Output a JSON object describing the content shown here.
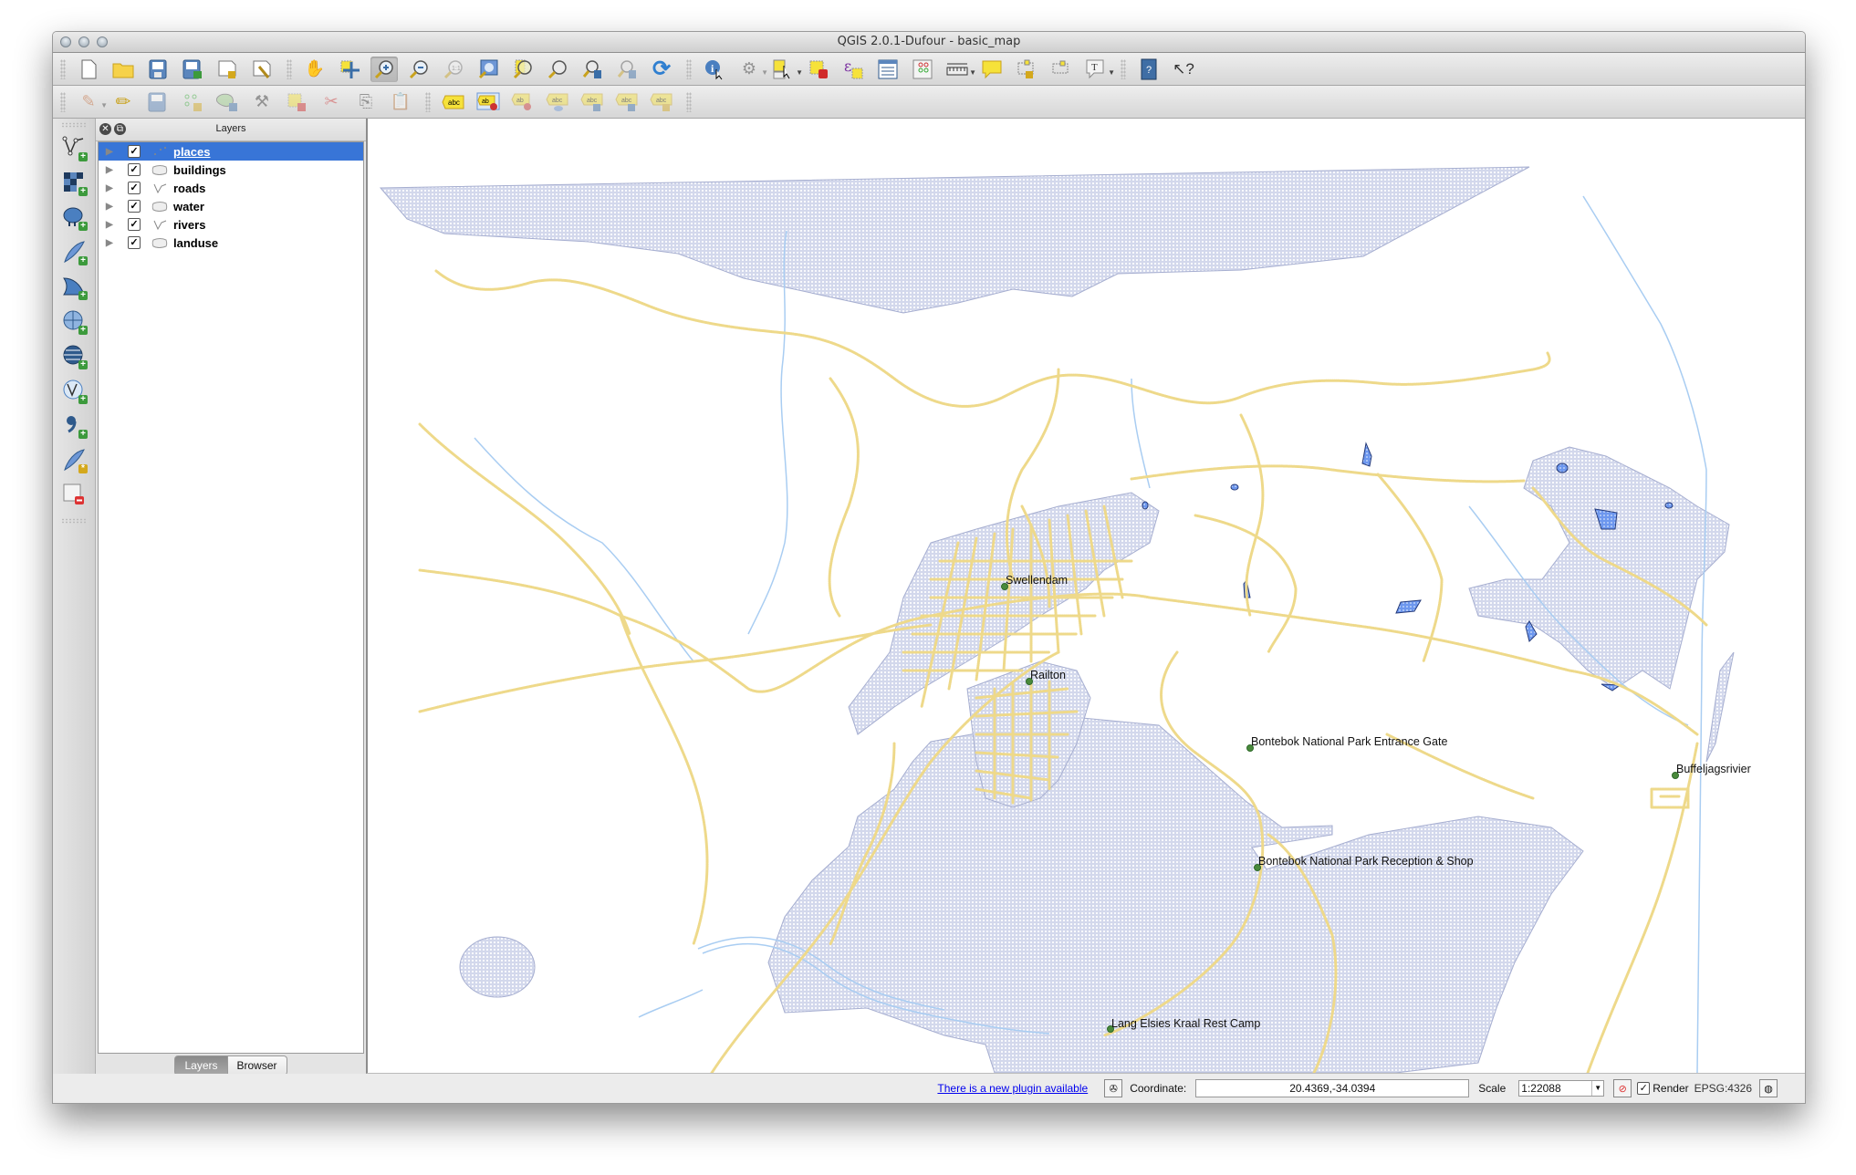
{
  "window": {
    "title": "QGIS 2.0.1-Dufour - basic_map"
  },
  "toolbar_main": [
    {
      "name": "new-project",
      "glyph": "🗋"
    },
    {
      "name": "open-project",
      "glyph": "📂"
    },
    {
      "name": "save-project",
      "glyph": "💾"
    },
    {
      "name": "save-project-as",
      "glyph": "💾"
    },
    {
      "name": "new-print-composer",
      "glyph": "🗋"
    },
    {
      "name": "composer-manager",
      "glyph": "🔧"
    },
    {
      "name": "pan-map",
      "glyph": "✋"
    },
    {
      "name": "pan-to-selection",
      "glyph": "✥"
    },
    {
      "name": "zoom-in",
      "glyph": "⊕"
    },
    {
      "name": "zoom-out",
      "glyph": "⊖"
    },
    {
      "name": "zoom-native",
      "glyph": "①"
    },
    {
      "name": "zoom-full",
      "glyph": "⤢"
    },
    {
      "name": "zoom-to-selection",
      "glyph": "🔍"
    },
    {
      "name": "zoom-to-layer",
      "glyph": "🔍"
    },
    {
      "name": "zoom-last",
      "glyph": "🔍"
    },
    {
      "name": "zoom-next",
      "glyph": "🔍"
    },
    {
      "name": "refresh",
      "glyph": "⟳"
    },
    {
      "name": "identify",
      "glyph": "ℹ"
    },
    {
      "name": "run-action",
      "glyph": "⚙"
    },
    {
      "name": "select-features",
      "glyph": "⬚"
    },
    {
      "name": "deselect-all",
      "glyph": "⊘"
    },
    {
      "name": "select-by-expression",
      "glyph": "ε"
    },
    {
      "name": "attribute-table",
      "glyph": "▤"
    },
    {
      "name": "field-calculator",
      "glyph": "⊞"
    },
    {
      "name": "measure",
      "glyph": "📏"
    },
    {
      "name": "map-tips",
      "glyph": "💬"
    },
    {
      "name": "new-bookmark",
      "glyph": "⬚"
    },
    {
      "name": "show-bookmarks",
      "glyph": "⬚"
    },
    {
      "name": "text-annotation",
      "glyph": "T"
    },
    {
      "name": "help-contents",
      "glyph": "?"
    },
    {
      "name": "whats-this",
      "glyph": "↖?"
    }
  ],
  "toolbar_edit": [
    {
      "name": "current-edits",
      "glyph": "✎"
    },
    {
      "name": "toggle-editing",
      "glyph": "✏"
    },
    {
      "name": "save-layer-edits",
      "glyph": "💾"
    },
    {
      "name": "add-feature",
      "glyph": "∴"
    },
    {
      "name": "move-feature",
      "glyph": "☁"
    },
    {
      "name": "node-tool",
      "glyph": "⚒"
    },
    {
      "name": "delete-selected",
      "glyph": "⊠"
    },
    {
      "name": "cut-features",
      "glyph": "✂"
    },
    {
      "name": "copy-features",
      "glyph": "⎘"
    },
    {
      "name": "paste-features",
      "glyph": "📋"
    },
    {
      "name": "label-tool",
      "glyph": "abc"
    },
    {
      "name": "pin-labels",
      "glyph": "ab"
    },
    {
      "name": "show-hide-labels",
      "glyph": "ab"
    },
    {
      "name": "highlight-pinned-labels",
      "glyph": "abc"
    },
    {
      "name": "move-label",
      "glyph": "abc"
    },
    {
      "name": "rotate-label",
      "glyph": "abc"
    },
    {
      "name": "change-label",
      "glyph": "abc"
    }
  ],
  "vertical_toolbar": [
    {
      "name": "add-vector-layer",
      "glyph": "V"
    },
    {
      "name": "add-raster-layer",
      "glyph": "▦"
    },
    {
      "name": "add-postgis-layer",
      "glyph": "🐘"
    },
    {
      "name": "add-spatialite-layer",
      "glyph": "✒"
    },
    {
      "name": "add-mssql-layer",
      "glyph": "◣"
    },
    {
      "name": "add-wms-layer",
      "glyph": "🌐"
    },
    {
      "name": "add-wcs-layer",
      "glyph": "🌐"
    },
    {
      "name": "add-wfs-layer",
      "glyph": "🌐"
    },
    {
      "name": "add-delimited-text-layer",
      "glyph": ","
    },
    {
      "name": "new-shapefile-layer",
      "glyph": "✒"
    },
    {
      "name": "remove-layer",
      "glyph": "□"
    }
  ],
  "layers_panel": {
    "title": "Layers",
    "layers": [
      {
        "name": "places",
        "type": "point",
        "checked": true,
        "selected": true
      },
      {
        "name": "buildings",
        "type": "polygon",
        "checked": true,
        "selected": false
      },
      {
        "name": "roads",
        "type": "line",
        "checked": true,
        "selected": false
      },
      {
        "name": "water",
        "type": "polygon",
        "checked": true,
        "selected": false
      },
      {
        "name": "rivers",
        "type": "line",
        "checked": true,
        "selected": false
      },
      {
        "name": "landuse",
        "type": "polygon",
        "checked": true,
        "selected": false
      }
    ],
    "tabs": [
      {
        "label": "Layers",
        "active": true
      },
      {
        "label": "Browser",
        "active": false
      }
    ]
  },
  "map": {
    "colors": {
      "landuse_fill": "#d3d8ec",
      "landuse_stroke": "#a6aed0",
      "road": "#eed98a",
      "river": "#a9cdf2",
      "water_fill": "#6d97ee",
      "water_stroke": "#243a7a",
      "place_point": "#4a8a3c"
    },
    "places": [
      {
        "name": "Swellendam"
      },
      {
        "name": "Railton"
      },
      {
        "name": "Bontebok National Park Entrance Gate"
      },
      {
        "name": "Buffeljagsrivier"
      },
      {
        "name": "Bontebok National Park Reception & Shop"
      },
      {
        "name": "Lang Elsies Kraal Rest Camp"
      }
    ]
  },
  "statusbar": {
    "plugin_link": "There is a new plugin available",
    "coordinate_label": "Coordinate:",
    "coordinate_value": "20.4369,-34.0394",
    "scale_label": "Scale",
    "scale_value": "1:22088",
    "render_label": "Render",
    "render_checked": true,
    "crs": "EPSG:4326"
  }
}
